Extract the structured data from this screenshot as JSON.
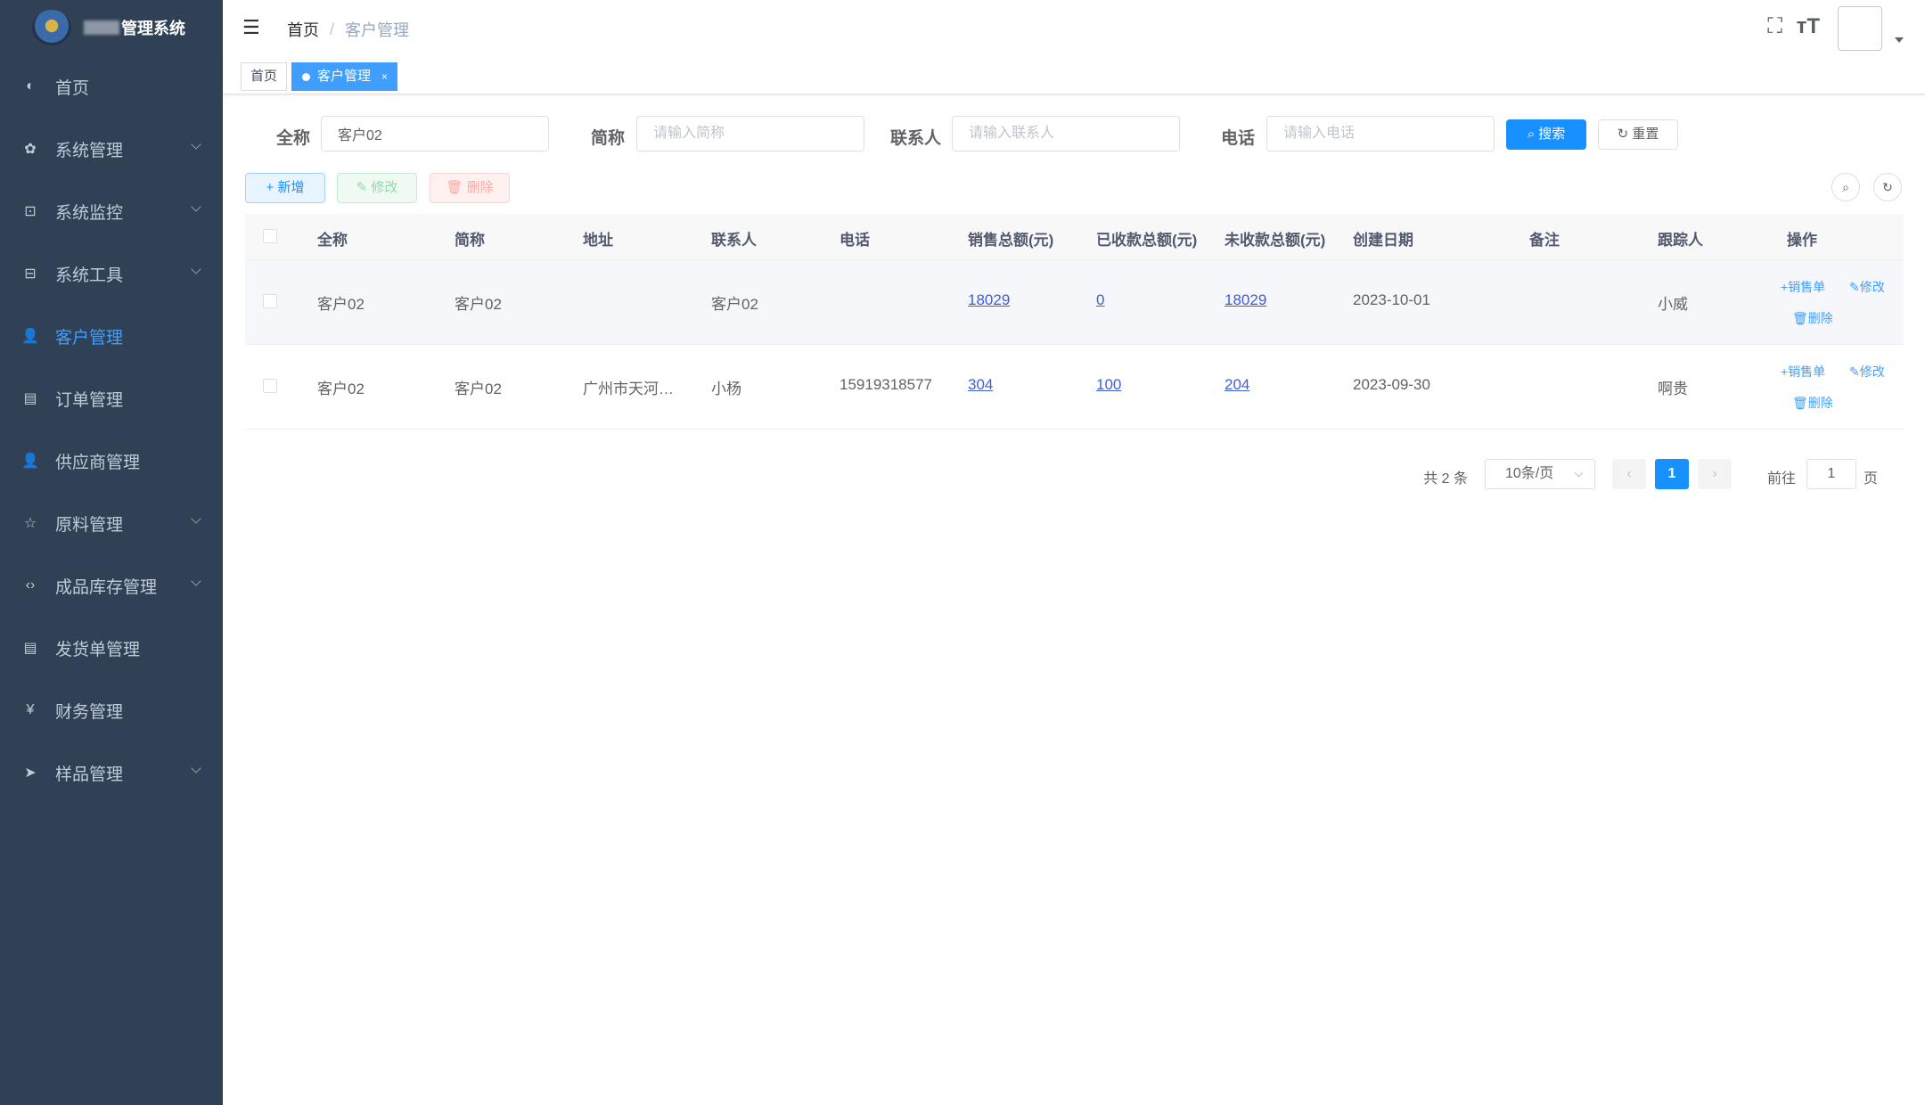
{
  "app": {
    "title_suffix": "管理系统"
  },
  "sidebar": {
    "items": [
      {
        "label": "首页",
        "icon": "dashboard-icon",
        "glyph": "◐"
      },
      {
        "label": "系统管理",
        "icon": "gear-icon",
        "glyph": "✿"
      },
      {
        "label": "系统监控",
        "icon": "monitor-icon",
        "glyph": "⊡"
      },
      {
        "label": "系统工具",
        "icon": "toolbox-icon",
        "glyph": "⊟"
      },
      {
        "label": "客户管理",
        "icon": "user-icon",
        "glyph": "👤"
      },
      {
        "label": "订单管理",
        "icon": "document-icon",
        "glyph": "▤"
      },
      {
        "label": "供应商管理",
        "icon": "users-icon",
        "glyph": "👤"
      },
      {
        "label": "原料管理",
        "icon": "star-icon",
        "glyph": "☆"
      },
      {
        "label": "成品库存管理",
        "icon": "code-icon",
        "glyph": "‹›"
      },
      {
        "label": "发货单管理",
        "icon": "document-icon",
        "glyph": "▤"
      },
      {
        "label": "财务管理",
        "icon": "yen-icon",
        "glyph": "¥"
      },
      {
        "label": "样品管理",
        "icon": "send-icon",
        "glyph": "➤"
      }
    ]
  },
  "navbar": {
    "breadcrumb": {
      "home": "首页",
      "sep": "/",
      "current": "客户管理"
    }
  },
  "tags": {
    "home": "首页",
    "active": "客户管理",
    "close": "×"
  },
  "query": {
    "fullname_label": "全称",
    "fullname_value": "客户02",
    "short_label": "简称",
    "short_placeholder": "请输入简称",
    "contact_label": "联系人",
    "contact_placeholder": "请输入联系人",
    "phone_label": "电话",
    "phone_placeholder": "请输入电话",
    "search": "搜索",
    "reset": "重置"
  },
  "toolbar": {
    "add": "+ 新增",
    "edit": "修改",
    "delete": "删除"
  },
  "table": {
    "headers": [
      "全称",
      "简称",
      "地址",
      "联系人",
      "电话",
      "销售总额(元)",
      "已收款总额(元)",
      "未收款总额(元)",
      "创建日期",
      "备注",
      "跟踪人",
      "操作"
    ],
    "rows": [
      [
        "客户02",
        "客户02",
        "",
        "客户02",
        "",
        "18029",
        "0",
        "18029",
        "2023-10-01",
        "",
        "小威"
      ],
      [
        "客户02",
        "客户02",
        "广州市天河…",
        "小杨",
        "15919318577",
        "304",
        "100",
        "204",
        "2023-09-30",
        "",
        "啊贵"
      ]
    ],
    "ops": {
      "sales": "销售单",
      "edit": "修改",
      "delete": "删除"
    }
  },
  "pagination": {
    "total": "共 2 条",
    "size": "10条/页",
    "page": "1",
    "goto": "前往",
    "goto_value": "1",
    "page_unit": "页"
  }
}
